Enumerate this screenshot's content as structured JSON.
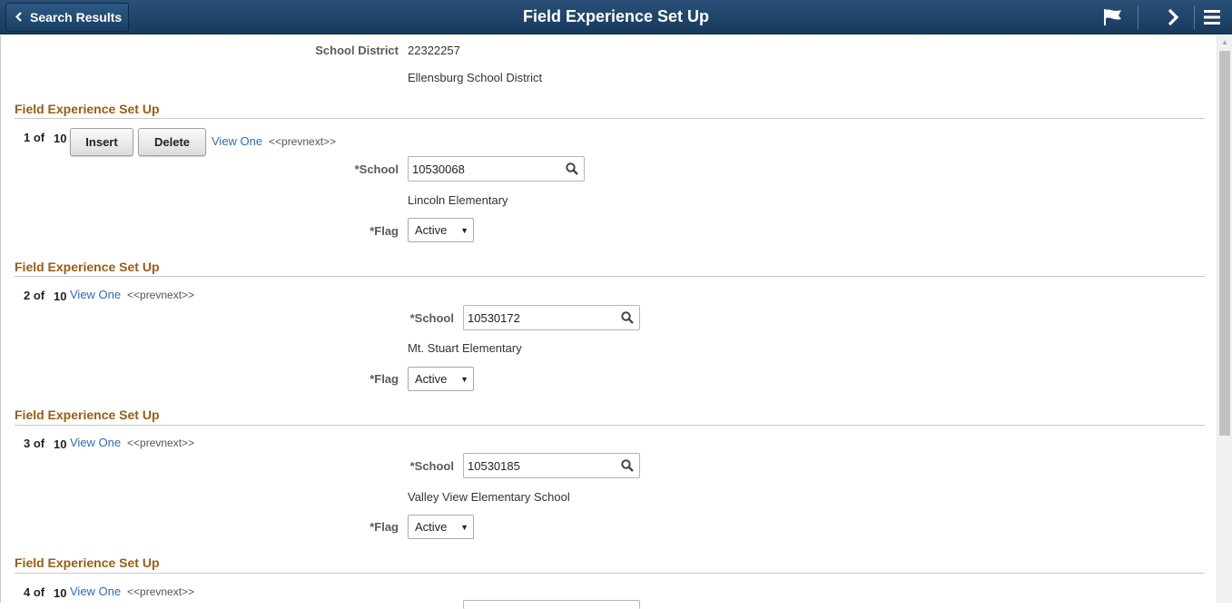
{
  "header": {
    "back_label": "Search Results",
    "title": "Field Experience Set Up"
  },
  "district": {
    "label": "School District",
    "id": "22322257",
    "name": "Ellensburg School District"
  },
  "buttons": {
    "insert": "Insert",
    "delete": "Delete"
  },
  "rows": [
    {
      "section_title": "Field Experience Set Up",
      "index": "1 of",
      "total": "10",
      "view_one": "View One",
      "prevnext": "<<prevnext>>",
      "school_label": "*School",
      "school_value": "10530068",
      "school_name": "Lincoln Elementary",
      "flag_label": "*Flag",
      "flag_value": "Active"
    },
    {
      "section_title": "Field Experience Set Up",
      "index": "2 of",
      "total": "10",
      "view_one": "View One",
      "prevnext": "<<prevnext>>",
      "school_label": "*School",
      "school_value": "10530172",
      "school_name": "Mt. Stuart Elementary",
      "flag_label": "*Flag",
      "flag_value": "Active"
    },
    {
      "section_title": "Field Experience Set Up",
      "index": "3 of",
      "total": "10",
      "view_one": "View One",
      "prevnext": "<<prevnext>>",
      "school_label": "*School",
      "school_value": "10530185",
      "school_name": "Valley View Elementary School",
      "flag_label": "*Flag",
      "flag_value": "Active"
    },
    {
      "section_title": "Field Experience Set Up",
      "index": "4 of",
      "total": "10",
      "view_one": "View One",
      "prevnext": "<<prevnext>>"
    }
  ]
}
